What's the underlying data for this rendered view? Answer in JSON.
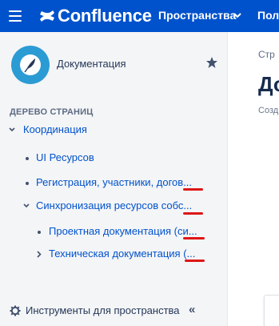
{
  "header": {
    "brand": "Confluence",
    "nav_spaces": "Пространства",
    "nav_more": "Пол"
  },
  "sidebar": {
    "space_name": "Документация",
    "tree_heading": "ДЕРЕВО СТРАНИЦ",
    "tree": [
      {
        "label": "Координация",
        "marker": "chevron-down"
      },
      {
        "label": "UI Ресурсов",
        "marker": "bullet"
      },
      {
        "label": "Регистрация, участники, догов...",
        "marker": "bullet"
      },
      {
        "label": "Синхронизация ресурсов собс...",
        "marker": "chevron-down"
      },
      {
        "label": "Проектная документация (си...",
        "marker": "bullet"
      },
      {
        "label": "Техническая документация (...",
        "marker": "chevron-right"
      }
    ],
    "footer_label": "Инструменты для пространства",
    "collapse_glyph": "«"
  },
  "main": {
    "breadcrumb": "Стр",
    "title": "До",
    "byline": "Созд"
  },
  "colors": {
    "nav_bg": "#0052cc",
    "link": "#0052cc",
    "sidebar_bg": "#f4f5f7",
    "annotation_red": "#de1616",
    "avatar": "#2b9bd4"
  }
}
